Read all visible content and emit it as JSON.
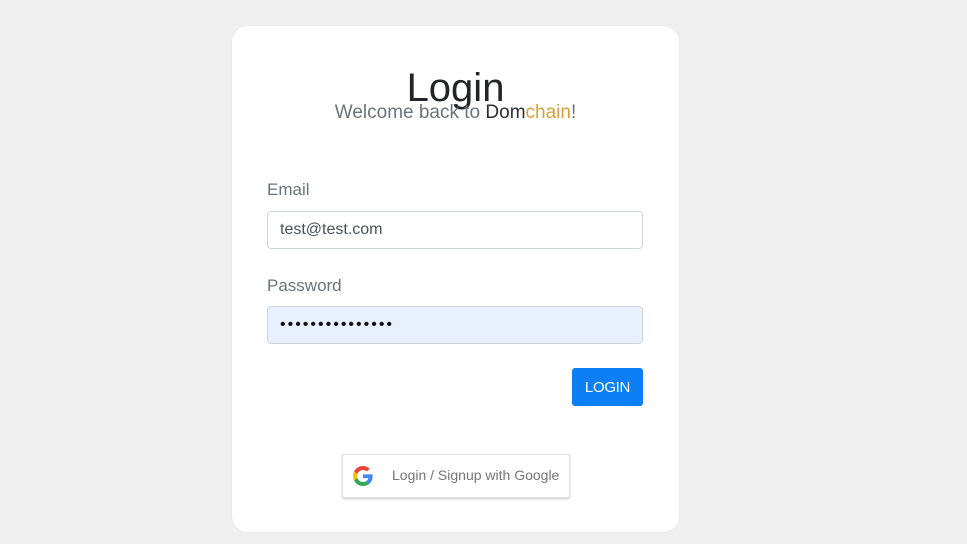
{
  "login": {
    "title": "Login",
    "subtitle_prefix": "Welcome back to ",
    "brand_part1": "Dom",
    "brand_part2": "chain",
    "subtitle_suffix": "!",
    "email_label": "Email",
    "email_value": "test@test.com",
    "password_label": "Password",
    "password_value": "•••••••••••••••",
    "login_button": "LOGIN",
    "google_button": "Login / Signup with Google",
    "google_icon": "google-g-icon"
  },
  "colors": {
    "background": "#efefef",
    "card": "#ffffff",
    "primary_button": "#0d7ff5",
    "brand_accent": "#d6a13a",
    "password_fill": "#e8f0fe"
  }
}
